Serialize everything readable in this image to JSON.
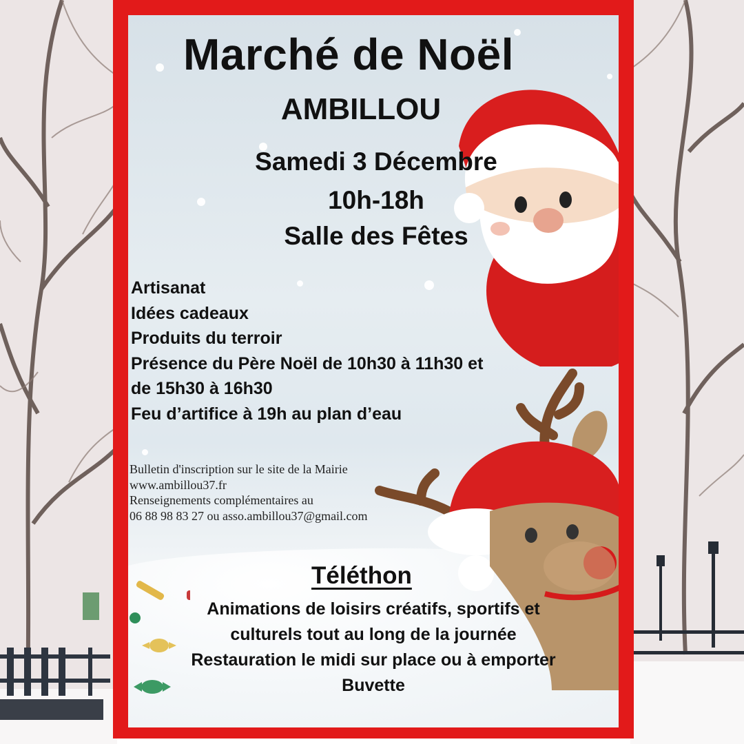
{
  "poster": {
    "title": "Marché de Noël",
    "subtitle": "AMBILLOU",
    "date": "Samedi 3 Décembre",
    "hours": "10h-18h",
    "venue": "Salle des Fêtes",
    "features": [
      "Artisanat",
      "Idées cadeaux",
      "Produits du terroir",
      "Présence du  Père Noël de 10h30 à 11h30 et",
      "de 15h30 à 16h30",
      "Feu d’artifice à 19h au plan d’eau"
    ],
    "info": [
      "Bulletin d'inscription sur le site de la Mairie",
      "www.ambillou37.fr",
      "Renseignements complémentaires au",
      "06 88 98 83 27 ou asso.ambillou37@gmail.com"
    ],
    "telethon_title": "Téléthon",
    "telethon_items": [
      "Animations de loisirs créatifs, sportifs et",
      "culturels tout au long de la journée",
      "Restauration le midi sur place ou à emporter",
      "Buvette"
    ]
  },
  "colors": {
    "frame": "#e21a1a",
    "text": "#111111",
    "santa_red": "#d91e1e",
    "reindeer_brown": "#b8946a"
  },
  "icons": [
    "santa-illustration",
    "reindeer-illustration",
    "candy-icon",
    "snowflake-icon"
  ]
}
